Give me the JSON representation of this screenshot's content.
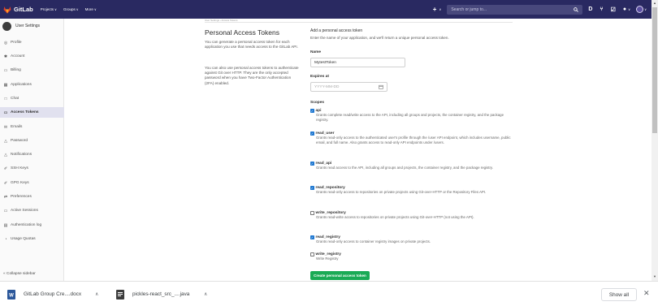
{
  "topbar": {
    "logo_text": "GitLab",
    "nav": [
      {
        "label": "Projects",
        "chev": "∨"
      },
      {
        "label": "Groups",
        "chev": "∨"
      },
      {
        "label": "More",
        "chev": "∨"
      }
    ],
    "plus_chev": "∨",
    "search_placeholder": "Search or jump to...",
    "help_chev": "∨",
    "avatar_chev": "∨"
  },
  "sidebar": {
    "title": "User Settings",
    "items": [
      {
        "label": "Profile",
        "icon": "◎",
        "active": false
      },
      {
        "label": "Account",
        "icon": "✱",
        "active": false
      },
      {
        "label": "Billing",
        "icon": "▭",
        "active": false
      },
      {
        "label": "Applications",
        "icon": "▦",
        "active": false
      },
      {
        "label": "Chat",
        "icon": "□",
        "active": false
      },
      {
        "label": "Access Tokens",
        "icon": "▭",
        "active": true
      },
      {
        "label": "Emails",
        "icon": "✉",
        "active": false
      },
      {
        "label": "Password",
        "icon": "△",
        "active": false
      },
      {
        "label": "Notifications",
        "icon": "△",
        "active": false
      },
      {
        "label": "SSH Keys",
        "icon": "✐",
        "active": false
      },
      {
        "label": "GPG Keys",
        "icon": "✐",
        "active": false
      },
      {
        "label": "Preferences",
        "icon": "⇄",
        "active": false
      },
      {
        "label": "Active Sessions",
        "icon": "▭",
        "active": false
      },
      {
        "label": "Authentication log",
        "icon": "▤",
        "active": false
      },
      {
        "label": "Usage Quotas",
        "icon": "◔",
        "active": false
      }
    ],
    "collapse_label": "«  Collapse sidebar"
  },
  "main": {
    "breadcrumb": "User Settings  ›  Access Tokens",
    "title": "Personal Access Tokens",
    "desc1": "You can generate a personal access token for each application you use that needs access to the GitLab API.",
    "desc2": "You can also use personal access tokens to authenticate against Git over HTTP. They are the only accepted password when you have Two-Factor Authentication (2FA) enabled.",
    "form_heading": "Add a personal access token",
    "form_sub": "Enter the name of your application, and we'll return a unique personal access token.",
    "name_label": "Name",
    "name_value": "MytestToken",
    "expires_label": "Expires at",
    "expires_placeholder": "YYYY-MM-DD",
    "scopes_label": "Scopes",
    "scopes": [
      {
        "name": "api",
        "checked": true,
        "desc": "Grants complete read/write access to the API, including all groups and projects, the container registry, and the package registry."
      },
      {
        "name": "read_user",
        "checked": true,
        "desc": "Grants read-only access to the authenticated user's profile through the /user API endpoint, which includes username, public email, and full name. Also grants access to read-only API endpoints under /users."
      },
      {
        "name": "read_api",
        "checked": true,
        "desc": "Grants read access to the API, including all groups and projects, the container registry, and the package registry."
      },
      {
        "name": "read_repository",
        "checked": true,
        "desc": "Grants read-only access to repositories on private projects using Git-over-HTTP or the Repository Files API."
      },
      {
        "name": "write_repository",
        "checked": false,
        "desc": "Grants read-write access to repositories on private projects using Git-over-HTTP (not using the API)."
      },
      {
        "name": "read_registry",
        "checked": true,
        "desc": "Grants read-only access to container registry images on private projects."
      },
      {
        "name": "write_registry",
        "checked": false,
        "desc": "Write Registry"
      }
    ],
    "create_button": "Create personal access token"
  },
  "downloads": {
    "items": [
      {
        "name": "GitLab Group Cre....docx",
        "icon": "word-doc-icon"
      },
      {
        "name": "pickles-react_src_....java",
        "icon": "java-file-icon"
      }
    ],
    "chev": "∧",
    "show_all": "Show all",
    "close": "✕"
  },
  "colors": {
    "topbar": "#292961",
    "active_item": "#e1e1ef",
    "checkbox": "#1f78d1",
    "create_button": "#1aaa55"
  }
}
